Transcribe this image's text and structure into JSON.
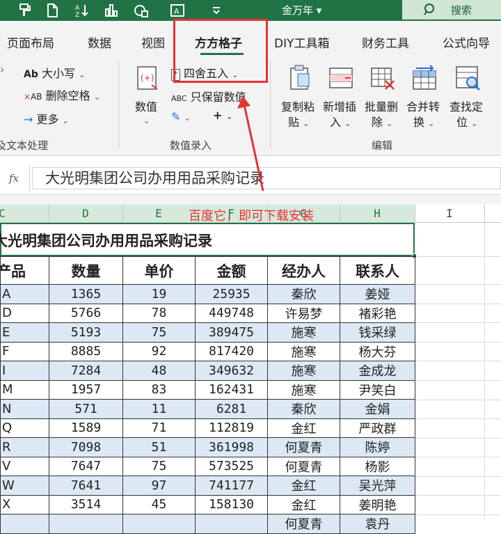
{
  "titlebar": {
    "doc_title": "金万年",
    "search_label": "搜索",
    "qat_icons": [
      "format-painter-icon",
      "new-doc-icon",
      "sort-az-icon",
      "bar-chart-icon",
      "shapes-icon",
      "textbox-icon",
      "customize-icon"
    ]
  },
  "tabs": [
    {
      "label": "页面布局"
    },
    {
      "label": "数据"
    },
    {
      "label": "视图"
    },
    {
      "label": "方方格子"
    },
    {
      "label": "DIY工具箱"
    },
    {
      "label": "财务工具"
    },
    {
      "label": "公式向导"
    }
  ],
  "ribbon": {
    "text_group": {
      "case_label": "大小写",
      "remove_space_label": "删除空格",
      "more_label": "更多",
      "group_label": "文本处理",
      "group_label_prefix": "及"
    },
    "value_group": {
      "value_btn": "数值",
      "round_label": "四舍五入",
      "keep_value_label": "只保留数值",
      "group_label": "数值录入"
    },
    "edit_group": {
      "copy_paste": [
        "复制粘",
        "贴"
      ],
      "new_insert": [
        "新增插",
        "入"
      ],
      "batch_delete": [
        "批量删",
        "除"
      ],
      "merge_convert": [
        "合并转",
        "换"
      ],
      "find_locate": [
        "查找定",
        "位"
      ],
      "group_label": "编辑"
    }
  },
  "formula_bar": {
    "fx_label": "fx",
    "value": "大光明集团公司办用用品采购记录"
  },
  "sheet": {
    "columns": [
      "C",
      "D",
      "E",
      "F",
      "G",
      "H",
      "I"
    ],
    "title": "大光明集团公司办用用品采购记录",
    "headers": [
      "产品",
      "数量",
      "单价",
      "金额",
      "经办人",
      "联系人"
    ],
    "rows": [
      [
        "A",
        "1365",
        "19",
        "25935",
        "秦欣",
        "姜娅"
      ],
      [
        "D",
        "5766",
        "78",
        "449748",
        "许易梦",
        "褚彩艳"
      ],
      [
        "E",
        "5193",
        "75",
        "389475",
        "施寒",
        "钱采绿"
      ],
      [
        "F",
        "8885",
        "92",
        "817420",
        "施寒",
        "杨大芬"
      ],
      [
        "I",
        "7284",
        "48",
        "349632",
        "施寒",
        "金成龙"
      ],
      [
        "M",
        "1957",
        "83",
        "162431",
        "施寒",
        "尹笑白"
      ],
      [
        "N",
        "571",
        "11",
        "6281",
        "秦欣",
        "金娟"
      ],
      [
        "Q",
        "1589",
        "71",
        "112819",
        "金红",
        "严政群"
      ],
      [
        "R",
        "7098",
        "51",
        "361998",
        "何夏青",
        "陈婷"
      ],
      [
        "V",
        "7647",
        "75",
        "573525",
        "何夏青",
        "杨影"
      ],
      [
        "W",
        "7641",
        "97",
        "741177",
        "金红",
        "吴光萍"
      ],
      [
        "X",
        "3514",
        "45",
        "158130",
        "金红",
        "姜明艳"
      ],
      [
        "",
        "",
        "",
        "",
        "何夏青",
        "袁丹"
      ]
    ]
  },
  "annotation": {
    "text": "百度它，即可下载安装",
    "color": "#e53333"
  },
  "colors": {
    "accent": "#217346",
    "band": "#dde8f5"
  }
}
